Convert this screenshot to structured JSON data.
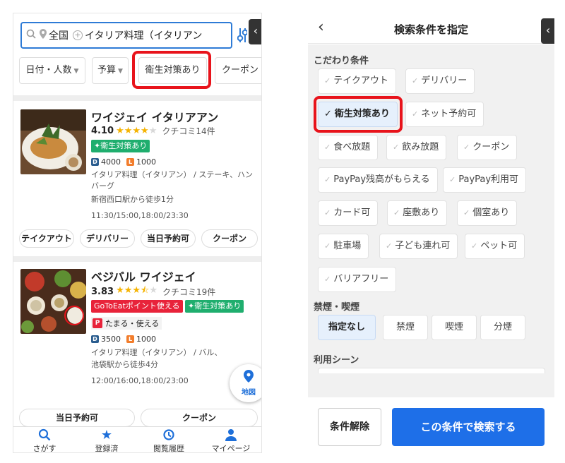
{
  "left": {
    "search": {
      "area": "全国",
      "keyword": "イタリア料理（イタリアン"
    },
    "filters": {
      "date_people": "日付・人数",
      "budget": "予算",
      "hygiene": "衛生対策あり",
      "coupon": "クーポン"
    },
    "restaurants": [
      {
        "name": "ワイジェイ イタリアアン",
        "rating": "4.10",
        "reviews": "クチコミ14件",
        "badges": [
          "衛生対策あり"
        ],
        "dinner_price": "4000",
        "lunch_price": "1000",
        "genre": "イタリア料理（イタリアン） / ステーキ、ハンバーグ",
        "access": "新宿西口駅から徒歩1分",
        "hours": "11:30/15:00,18:00/23:30",
        "buttons": [
          "テイクアウト",
          "デリバリー",
          "当日予約可",
          "クーポン"
        ]
      },
      {
        "name": "ベジバル ワイジェイ",
        "rating": "3.83",
        "reviews": "クチコミ19件",
        "badges": [
          "GoToEatポイント使える",
          "衛生対策あり"
        ],
        "paypay": "たまる・使える",
        "dinner_price": "3500",
        "lunch_price": "1000",
        "genre": "イタリア料理（イタリアン） / バル、",
        "access": "池袋駅から徒歩4分",
        "hours": "12:00/16:00,18:00/23:00",
        "buttons": [
          "当日予約可",
          "クーポン"
        ]
      }
    ],
    "map_label": "地図",
    "tabs": [
      "さがす",
      "登録済",
      "閲覧履歴",
      "マイページ"
    ]
  },
  "right": {
    "title": "検索条件を指定",
    "sections": {
      "kodawari": "こだわり条件",
      "smoking": "禁煙・喫煙",
      "scene": "利用シーン"
    },
    "options": [
      "テイクアウト",
      "デリバリー",
      "衛生対策あり",
      "ネット予約可",
      "食べ放題",
      "飲み放題",
      "クーポン",
      "PayPay残高がもらえる",
      "PayPay利用可",
      "カード可",
      "座敷あり",
      "個室あり",
      "駐車場",
      "子ども連れ可",
      "ペット可",
      "バリアフリー"
    ],
    "smoking_options": [
      "指定なし",
      "禁煙",
      "喫煙",
      "分煙"
    ],
    "clear_label": "条件解除",
    "search_label": "この条件で検索する"
  },
  "colors": {
    "accent_blue": "#1e6fe8",
    "highlight_red": "#e8131b",
    "badge_green": "#1fae6e",
    "star": "#f5b301"
  }
}
